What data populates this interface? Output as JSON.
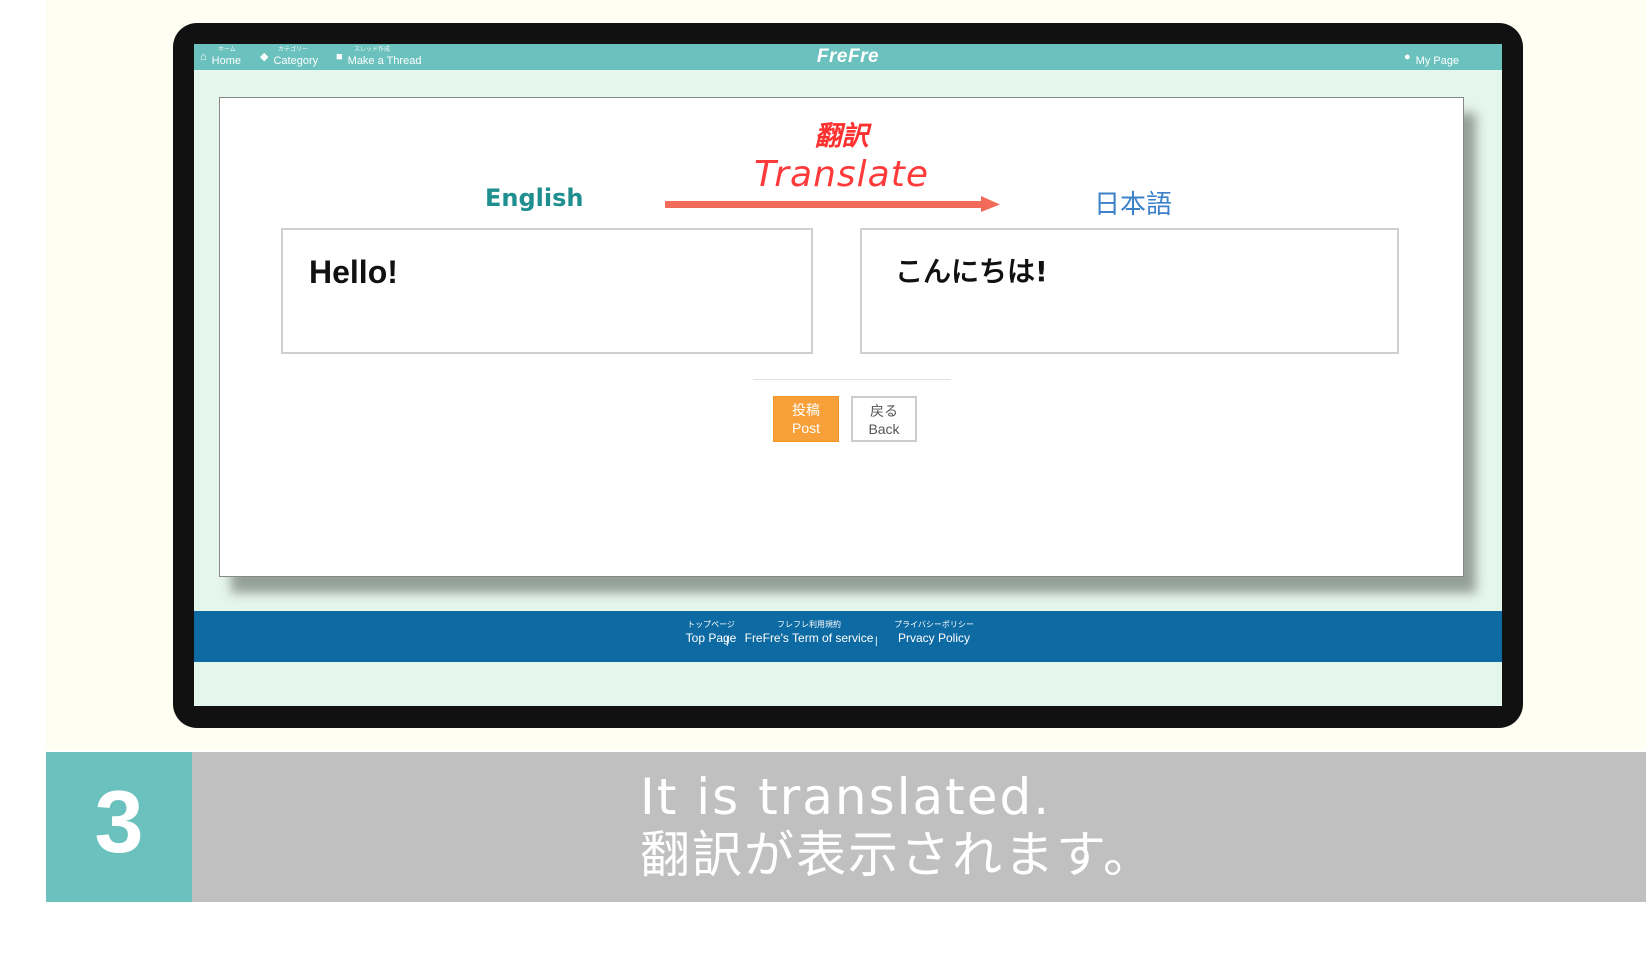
{
  "topbar": {
    "home": {
      "label": "Home",
      "sup": "ホーム",
      "icon": "home-icon"
    },
    "category": {
      "label": "Category",
      "sup": "カテゴリー",
      "icon": "tag-icon"
    },
    "make_thread": {
      "label": "Make a Thread",
      "sup": "スレッド作成",
      "icon": "comment-icon"
    },
    "brand": "FreFre",
    "my_page": {
      "label": "My Page",
      "icon": "user-icon"
    }
  },
  "translate": {
    "title_jp": "翻訳",
    "title_en": "Translate",
    "source_lang": "English",
    "target_lang": "日本語",
    "source_text": "Hello!",
    "translated_text": "こんにちは!"
  },
  "buttons": {
    "post_jp": "投稿",
    "post_en": "Post",
    "back_jp": "戻る",
    "back_en": "Back"
  },
  "footer": {
    "top_page": {
      "jp": "トップページ",
      "en": "Top Page"
    },
    "terms": {
      "jp": "フレフレ利用規約",
      "en": "FreFre's Term of service"
    },
    "privacy": {
      "jp": "プライバシーポリシー",
      "en": "Prvacy Policy"
    },
    "separator": "|"
  },
  "step": {
    "number": "3",
    "line1": "It is translated.",
    "line2": "翻訳が表示されます。"
  },
  "colors": {
    "accent_teal": "#6ac1bd",
    "footer_blue": "#0d6aa3",
    "post_orange": "#f7a03a",
    "title_red": "#ff3030",
    "english_teal": "#1f8e8f",
    "japanese_blue": "#3c81c9"
  }
}
